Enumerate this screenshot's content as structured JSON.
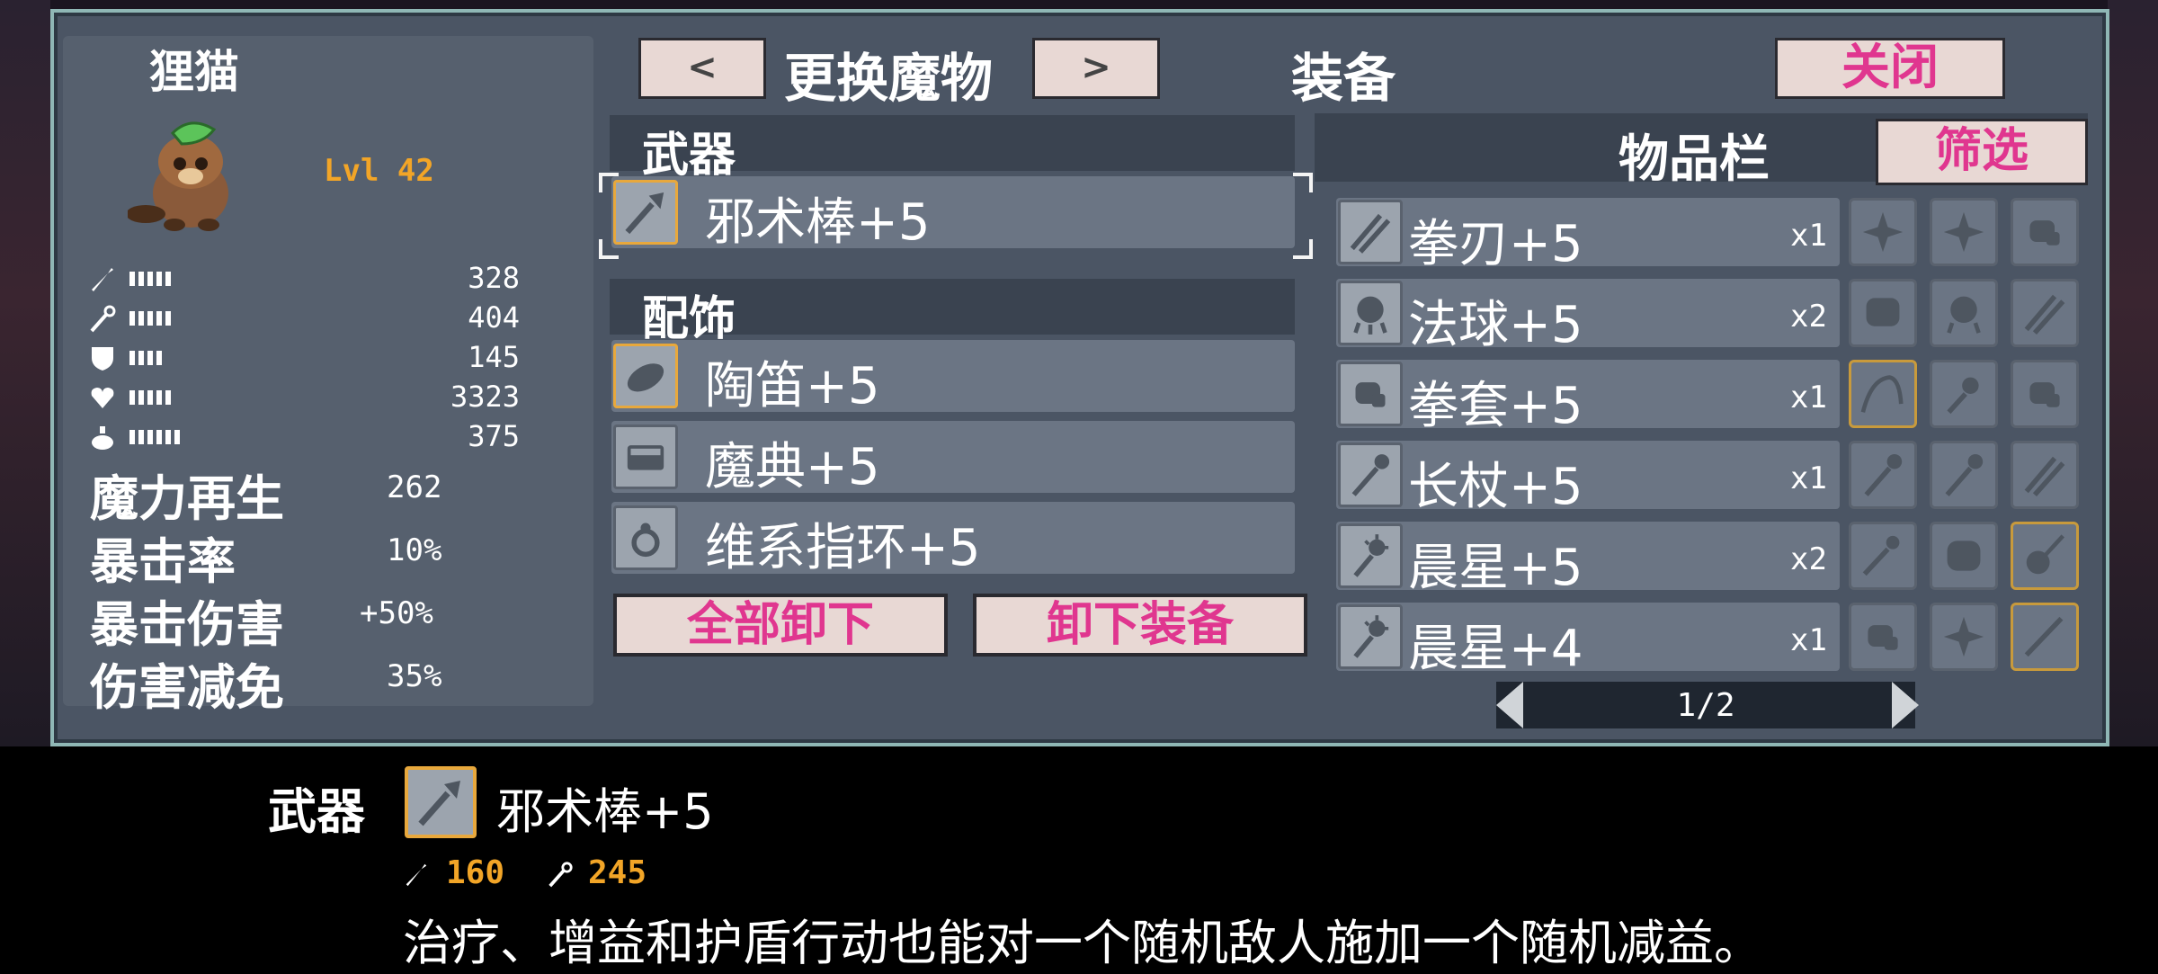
{
  "monster": {
    "name": "狸猫",
    "level": "Lvl 42"
  },
  "stats": [
    {
      "icon": "sword-icon",
      "bars": 5,
      "value": "328"
    },
    {
      "icon": "wand-icon",
      "bars": 5,
      "value": "404"
    },
    {
      "icon": "shield-icon",
      "bars": 4,
      "value": "145"
    },
    {
      "icon": "heart-icon",
      "bars": 5,
      "value": "3323"
    },
    {
      "icon": "potion-icon",
      "bars": 6,
      "value": "375"
    }
  ],
  "attributes": [
    {
      "label": "魔力再生",
      "value": "262"
    },
    {
      "label": "暴击率",
      "value": "10%"
    },
    {
      "label": "暴击伤害",
      "value": "+50%"
    },
    {
      "label": "伤害减免",
      "value": "35%"
    }
  ],
  "header": {
    "prev_label": "<",
    "change_monster": "更换魔物",
    "next_label": ">",
    "equipment_title": "装备",
    "close_label": "关闭"
  },
  "equipment": {
    "weapon_header": "武器",
    "weapon": {
      "name": "邪术棒+5",
      "icon": "staff-icon"
    },
    "accessory_header": "配饰",
    "accessories": [
      {
        "name": "陶笛+5",
        "icon": "ocarina-icon"
      },
      {
        "name": "魔典+5",
        "icon": "tome-icon"
      },
      {
        "name": "维系指环+5",
        "icon": "ring-icon"
      }
    ],
    "unequip_all_label": "全部卸下",
    "unequip_label": "卸下装备"
  },
  "inventory": {
    "title": "物品栏",
    "filter_label": "筛选",
    "items": [
      {
        "name": "拳刃+5",
        "count": "x1",
        "icon": "claw-icon"
      },
      {
        "name": "法球+5",
        "count": "x2",
        "icon": "orb-icon"
      },
      {
        "name": "拳套+5",
        "count": "x1",
        "icon": "gauntlet-icon"
      },
      {
        "name": "长杖+5",
        "count": "x1",
        "icon": "staff-icon"
      },
      {
        "name": "晨星+5",
        "count": "x2",
        "icon": "morningstar-icon"
      },
      {
        "name": "晨星+4",
        "count": "x1",
        "icon": "morningstar-icon"
      }
    ],
    "page": "1/2"
  },
  "detail": {
    "slot_label": "武器",
    "item_name": "邪术棒+5",
    "attack": "160",
    "magic": "245",
    "description": "治疗、增益和护盾行动也能对一个随机敌人施加一个随机减益。"
  },
  "colors": {
    "panel_border": "#8fb7b5",
    "panel_bg": "#4b5564",
    "gold": "#f2a527",
    "pink": "#e0368f"
  }
}
